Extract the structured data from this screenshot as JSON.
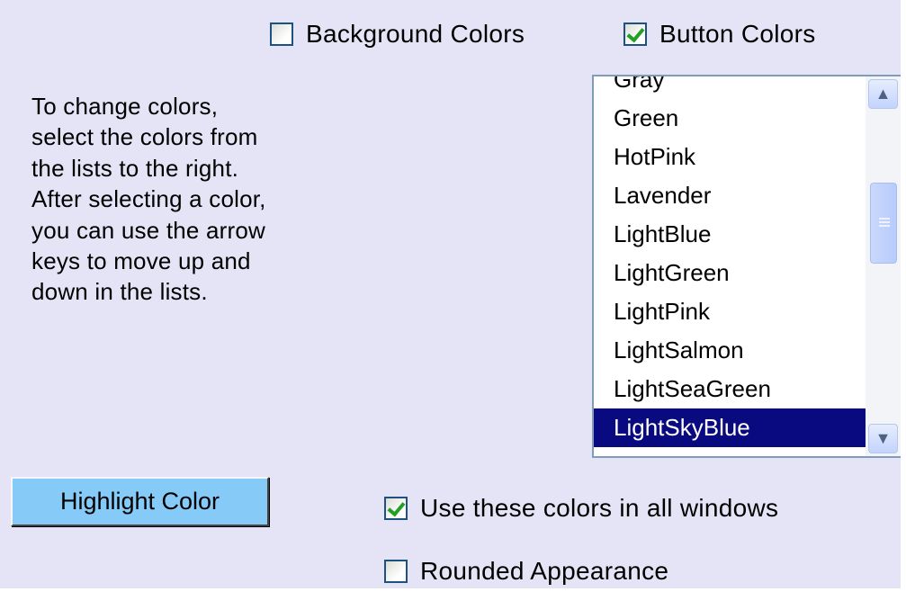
{
  "top_options": {
    "background_colors": {
      "label": "Background Colors",
      "checked": false
    },
    "button_colors": {
      "label": "Button Colors",
      "checked": true
    }
  },
  "instructions": "To change colors, select the colors from the lists to the right. After selecting a color, you can use the arrow keys to move up and down in the lists.",
  "color_list": {
    "items": [
      "Gray",
      "Green",
      "HotPink",
      "Lavender",
      "LightBlue",
      "LightGreen",
      "LightPink",
      "LightSalmon",
      "LightSeaGreen",
      "LightSkyBlue"
    ],
    "selected": "LightSkyBlue",
    "selection_color": "#0a0a80"
  },
  "highlight_button": {
    "label": "Highlight Color",
    "color": "#86caf7"
  },
  "bottom_options": {
    "use_all_windows": {
      "label": "Use these colors in all windows",
      "checked": true
    },
    "rounded": {
      "label": "Rounded Appearance",
      "checked": false
    }
  },
  "icons": {
    "scroll_up": "chevron-up-icon",
    "scroll_down": "chevron-down-icon",
    "thumb_grip": "grip-icon"
  },
  "colors": {
    "panel_background": "#e4e4f6",
    "checkmark": "#22a022"
  }
}
